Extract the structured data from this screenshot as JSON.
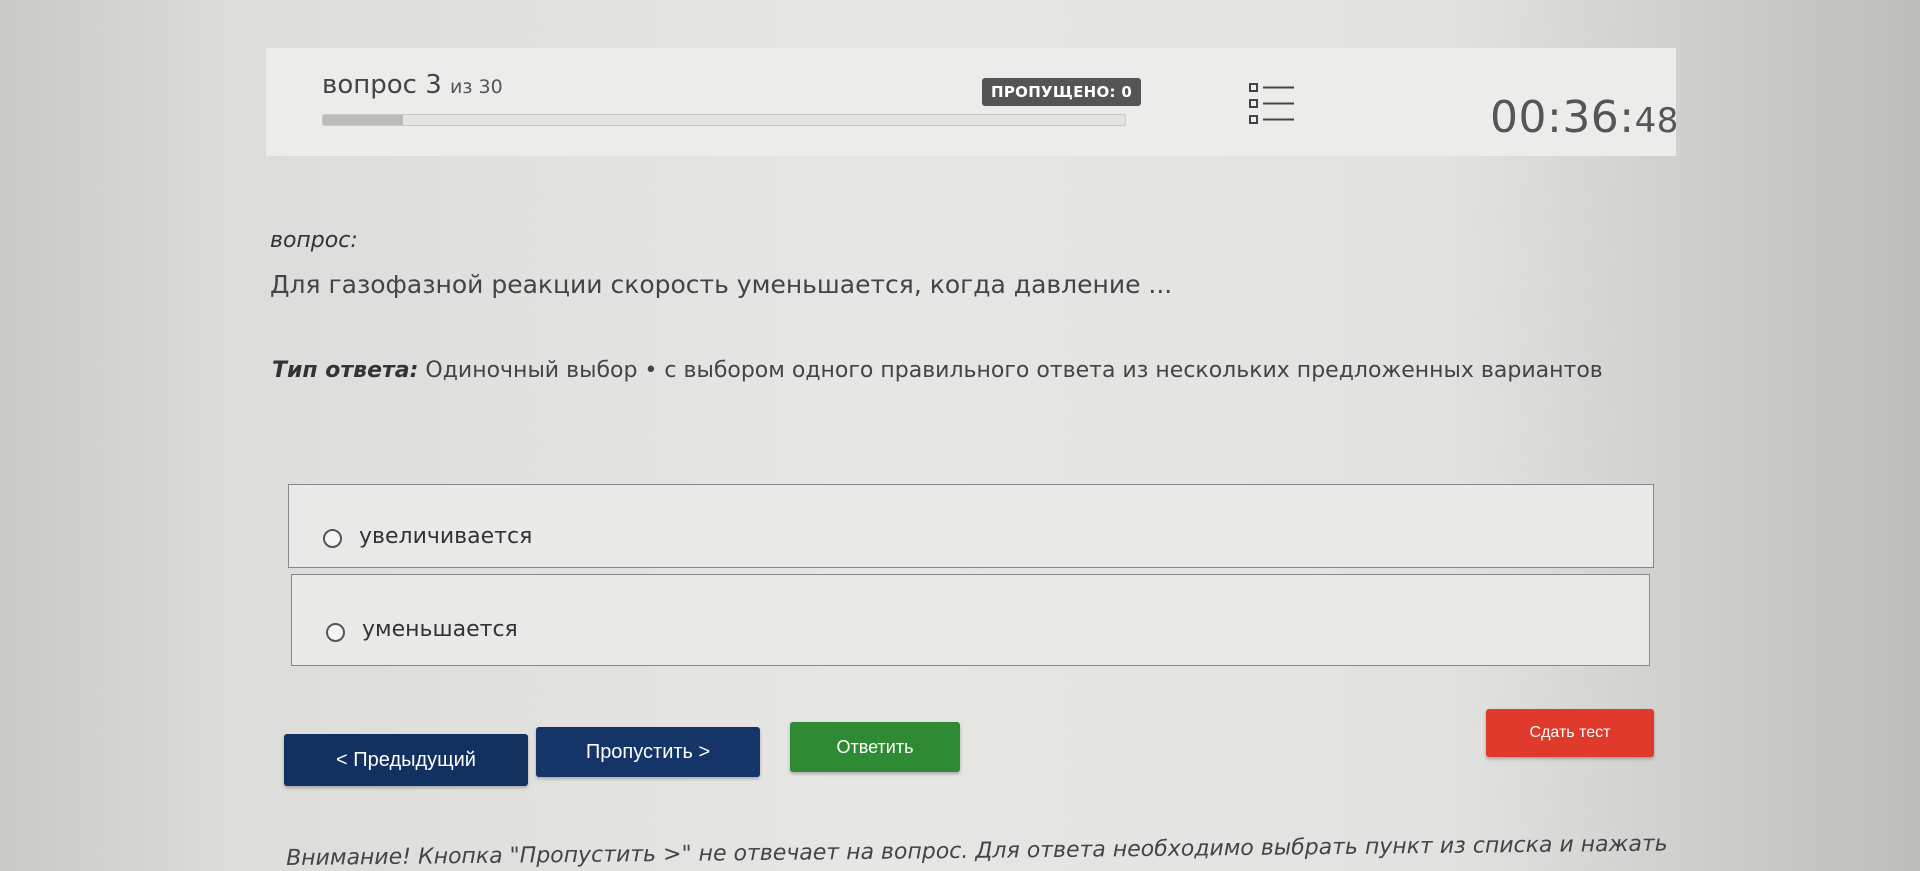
{
  "header": {
    "question_word": "вопрос",
    "current": "3",
    "total_label": "из 30",
    "progress_fraction": 0.1,
    "skipped_label": "ПРОПУЩЕНО: 0",
    "timer_main": "00:36:",
    "timer_seconds": "48"
  },
  "question": {
    "section_label": "вопрос:",
    "text": "Для газофазной реакции скорость уменьшается, когда давление ..."
  },
  "answer_type": {
    "label": "Тип ответа:",
    "value": "Одиночный выбор • с выбором одного правильного ответа из нескольких предложенных вариантов"
  },
  "options": [
    {
      "label": "увеличивается",
      "selected": false
    },
    {
      "label": "уменьшается",
      "selected": false
    }
  ],
  "buttons": {
    "prev": "< Предыдущий",
    "skip": "Пропустить >",
    "answer": "Ответить",
    "submit": "Сдать тест"
  },
  "notice": "Внимание! Кнопка \"Пропустить >\" не отвечает на вопрос. Для ответа необходимо выбрать пункт из списка и нажать",
  "colors": {
    "nav_button": "#123160",
    "answer_button": "#2e8b34",
    "submit_button": "#df3a2c",
    "badge": "#555555"
  },
  "icons": {
    "question_list": "list-icon",
    "radio": "radio-icon"
  }
}
